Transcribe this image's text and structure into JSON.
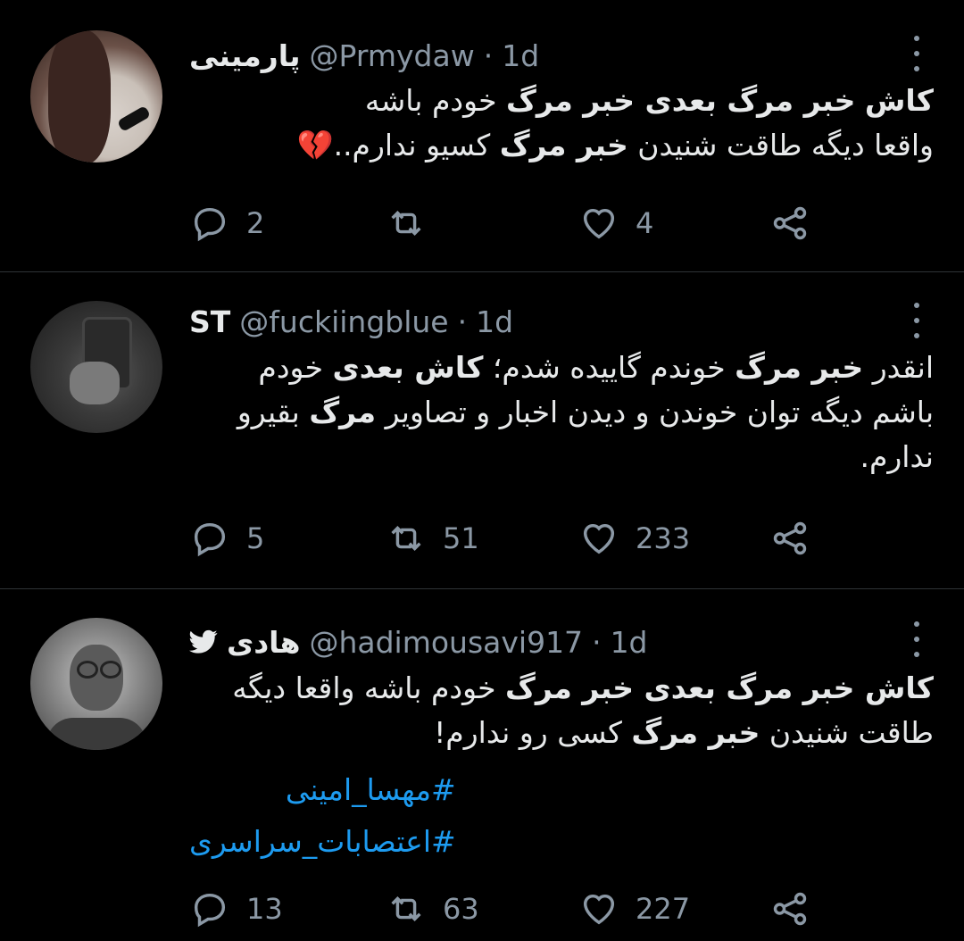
{
  "tweets": [
    {
      "name": "پارمینی",
      "handle": "@Prmydaw",
      "separator": "·",
      "time": "1d",
      "body_lines": [
        [
          {
            "t": "کاش",
            "b": true
          },
          {
            "t": " "
          },
          {
            "t": "خبر مرگ بعدی خبر مرگ",
            "b": true
          },
          {
            "t": " خودم باشه"
          }
        ],
        [
          {
            "t": "واقعا دیگه طاقت شنیدن "
          },
          {
            "t": "خبر مرگ",
            "b": true
          },
          {
            "t": " کسیو ندارم..💔"
          }
        ]
      ],
      "replies": "2",
      "retweets": "",
      "likes": "4"
    },
    {
      "name": "ST",
      "handle": "@fuckiingblue",
      "separator": "·",
      "time": "1d",
      "body_lines": [
        [
          {
            "t": "انقدر "
          },
          {
            "t": "خبر مرگ",
            "b": true
          },
          {
            "t": " خوندم گاییده شدم؛ "
          },
          {
            "t": "کاش بعدی",
            "b": true
          },
          {
            "t": " خودم"
          }
        ],
        [
          {
            "t": "باشم دیگه توان خوندن و دیدن اخبار و تصاویر "
          },
          {
            "t": "مرگ",
            "b": true
          },
          {
            "t": " بقیرو"
          }
        ],
        [
          {
            "t": "ندارم."
          }
        ]
      ],
      "replies": "5",
      "retweets": "51",
      "likes": "233"
    },
    {
      "name": "هادی",
      "handle": "@hadimousavi917",
      "separator": "·",
      "time": "1d",
      "body_lines": [
        [
          {
            "t": "کاش خبر مرگ بعدی خبر مرگ",
            "b": true
          },
          {
            "t": " خودم باشه واقعا دیگه"
          }
        ],
        [
          {
            "t": "طاقت شنیدن "
          },
          {
            "t": "خبر مرگ",
            "b": true
          },
          {
            "t": " کسی رو ندارم!"
          }
        ]
      ],
      "hashtags": [
        "#مهسا_امینی",
        "#اعتصابات_سراسری"
      ],
      "replies": "13",
      "retweets": "63",
      "likes": "227"
    }
  ],
  "colors": {
    "background": "#000000",
    "text": "#e7e9ea",
    "muted": "#8b98a5",
    "link": "#1d9bf0",
    "divider": "#2f3336"
  },
  "icons": {
    "reply": "reply-icon",
    "retweet": "retweet-icon",
    "like": "like-icon",
    "share": "share-icon",
    "more": "more-icon",
    "bird": "twitter-bird-icon"
  }
}
